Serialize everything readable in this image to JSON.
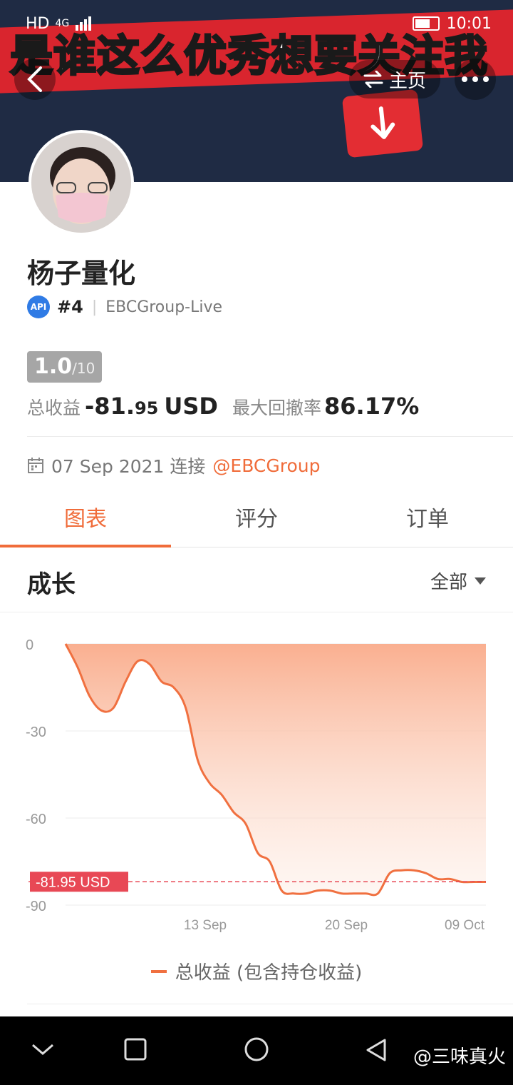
{
  "status_bar": {
    "left": "HD",
    "network": "4G",
    "time": "10:01"
  },
  "banner": {
    "text": "是谁这么优秀想要关注我"
  },
  "header": {
    "home_label": "主页"
  },
  "profile": {
    "name": "杨子量化",
    "api_badge": "API",
    "rank": "#4",
    "broker": "EBCGroup-Live",
    "score": "1.0",
    "score_max": "/10",
    "total_label": "总收益",
    "total_value": "-81.",
    "total_cents": "95",
    "total_unit": "USD",
    "drawdown_label": "最大回撤率",
    "drawdown_value": "86.17%",
    "connect_date": "07 Sep 2021 连接",
    "connect_account": "@EBCGroup"
  },
  "tabs": [
    {
      "label": "图表",
      "active": true
    },
    {
      "label": "评分",
      "active": false
    },
    {
      "label": "订单",
      "active": false
    }
  ],
  "section": {
    "title": "成长",
    "filter": "全部"
  },
  "chart_data": {
    "type": "area",
    "y_ticks": [
      "0",
      "-30",
      "-60",
      "-90"
    ],
    "ylim": [
      -90,
      0
    ],
    "x_ticks": [
      "13 Sep",
      "20 Sep",
      "09 Oct"
    ],
    "current_label": "-81.95 USD",
    "current_value": -81.95,
    "series": [
      {
        "name": "总收益 (包含持仓收益)",
        "color": "#f07040",
        "values": [
          0,
          -8,
          -18,
          -23,
          -22,
          -13,
          -6,
          -7,
          -13,
          -15,
          -22,
          -40,
          -48,
          -52,
          -58,
          -62,
          -72,
          -75,
          -85,
          -86,
          -86,
          -85,
          -85,
          -86,
          -86,
          -86,
          -86,
          -79,
          -78,
          -78,
          -79,
          -81,
          -81,
          -82,
          -82,
          -82
        ]
      }
    ]
  },
  "legend": {
    "label": "总收益 (包含持仓收益)"
  },
  "watermark": "@三味真火"
}
